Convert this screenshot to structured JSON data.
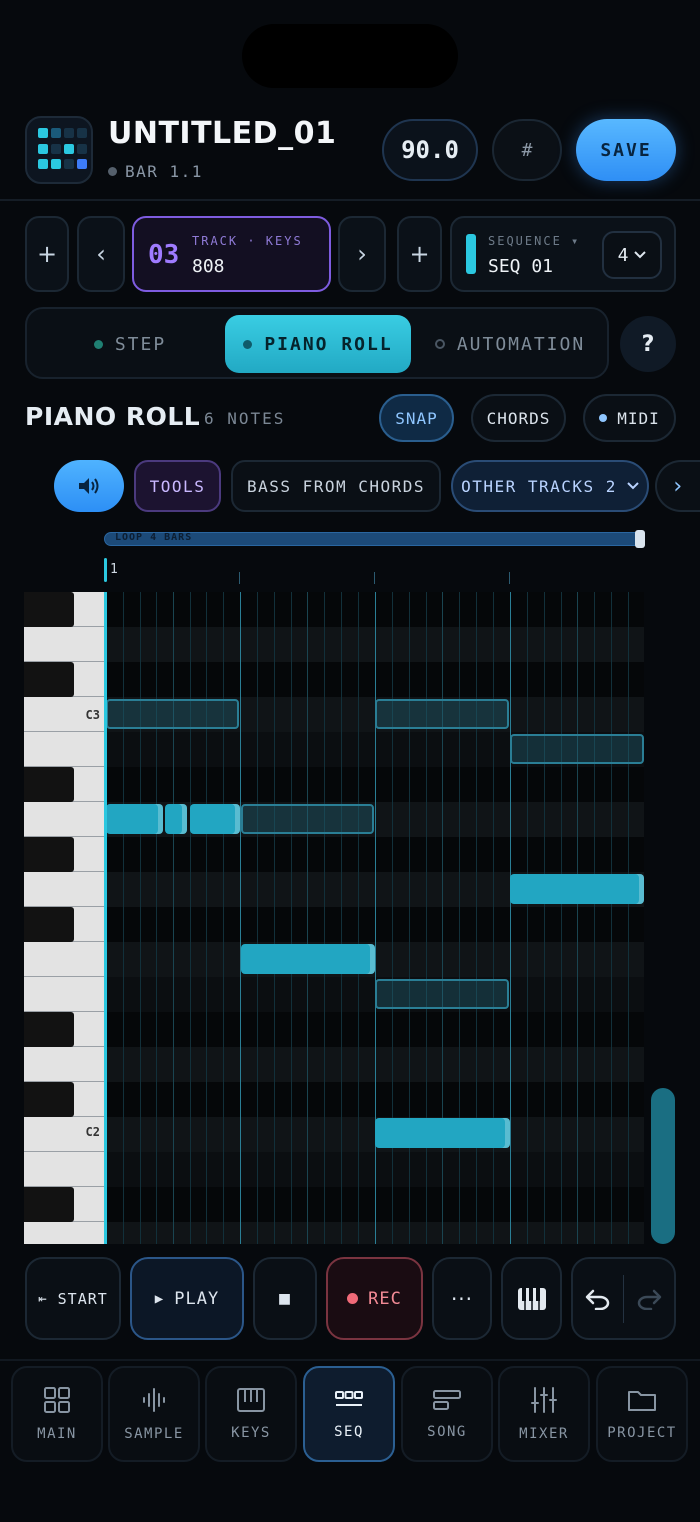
{
  "header": {
    "project_title": "UNTITLED_01",
    "bar_position": "BAR 1.1",
    "tempo": "90.0",
    "grid_symbol": "#",
    "save_label": "SAVE"
  },
  "track_row": {
    "add_left": "+",
    "prev": "‹",
    "track_number": "03",
    "track_caption": "TRACK · KEYS",
    "track_name": "808",
    "next": "›",
    "add_right": "+",
    "sequence_caption": "SEQUENCE ▾",
    "sequence_name": "SEQ 01",
    "sequence_count": "4"
  },
  "modes": {
    "tabs": [
      "STEP",
      "PIANO ROLL",
      "AUTOMATION"
    ],
    "active": "PIANO ROLL",
    "help": "?"
  },
  "roll_header": {
    "title": "PIANO ROLL",
    "note_count": "6 NOTES",
    "snap": "SNAP",
    "chords": "CHORDS",
    "midi": "MIDI"
  },
  "toolbar": {
    "tools": "TOOLS",
    "bass_from_chords": "BASS FROM CHORDS",
    "other_tracks": "OTHER TRACKS 2",
    "more": "›"
  },
  "piano_roll": {
    "loop_label": "LOOP 4 BARS",
    "bar_start": "1",
    "key_labels": {
      "c3": "C3",
      "c2": "C2"
    }
  },
  "transport": {
    "start": "START",
    "play": "PLAY",
    "stop": "■",
    "rec": "REC",
    "more": "···"
  },
  "nav": {
    "items": [
      "MAIN",
      "SAMPLE",
      "KEYS",
      "SEQ",
      "SONG",
      "MIXER",
      "PROJECT"
    ],
    "active": "SEQ"
  },
  "colors": {
    "accent_cyan": "#2bc8e0",
    "accent_blue": "#3d9cf7",
    "track_purple": "#7e5ce0",
    "rec_red": "#f06a78",
    "background": "#06090d"
  }
}
